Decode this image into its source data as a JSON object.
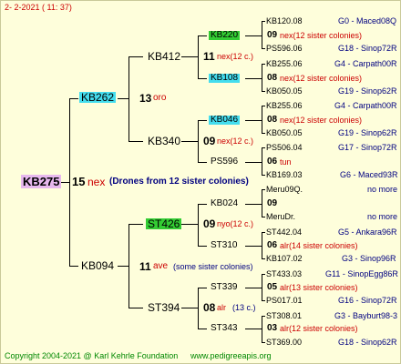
{
  "header": {
    "date": "2-  2-2021  ( 11: 37)"
  },
  "colors": {
    "background": "#fefedb",
    "highlight_blue": "#44ddee",
    "highlight_green": "#33cc33",
    "root_highlight": "#e7b8ee",
    "mating_red": "#cc0000",
    "code_blue": "#000080",
    "footer_green": "#008800"
  },
  "root": {
    "name": "KB275",
    "num": "15",
    "mating": "nex",
    "note": "(Drones from 12 sister colonies)"
  },
  "g1": [
    {
      "name": "KB262",
      "num": "13",
      "mating": "oro"
    },
    {
      "name": "KB094",
      "num": "11",
      "mating": "ave",
      "note": "(some sister colonies)"
    }
  ],
  "g2": [
    {
      "name": "KB412",
      "num": "11",
      "mating": "nex(12 c.)"
    },
    {
      "name": "KB340",
      "num": "09",
      "mating": "nex(12 c.)"
    },
    {
      "name": "ST426",
      "num": "09",
      "mating": "nyo(12 c.)"
    },
    {
      "name": "ST394",
      "num": "08",
      "mating": "alr",
      "note": "(13 c.)"
    }
  ],
  "g3": [
    {
      "name": "KB220",
      "num": "09",
      "mating": "nex(12 sister colonies)"
    },
    {
      "name": "KB108",
      "num": "08",
      "mating": "nex(12 sister colonies)"
    },
    {
      "name": "KB046",
      "num": "08",
      "mating": "nex(12 sister colonies)"
    },
    {
      "name": "PS596",
      "num": "06",
      "mating": "tun"
    },
    {
      "name": "KB024",
      "num": "09",
      "mating": ""
    },
    {
      "name": "ST310",
      "num": "06",
      "mating": "alr(14 sister colonies)"
    },
    {
      "name": "ST339",
      "num": "05",
      "mating": "alr(13 sister colonies)"
    },
    {
      "name": "ST343",
      "num": "03",
      "mating": "alr(12 sister colonies)"
    }
  ],
  "g4": [
    {
      "name": "KB120.08",
      "code": "G0 - Maced08Q"
    },
    {
      "name": "PS596.06",
      "code": "G18 - Sinop72R"
    },
    {
      "name": "KB255.06",
      "code": "G4 - Carpath00R"
    },
    {
      "name": "KB050.05",
      "code": "G19 - Sinop62R"
    },
    {
      "name": "KB255.06",
      "code": "G4 - Carpath00R"
    },
    {
      "name": "KB050.05",
      "code": "G19 - Sinop62R"
    },
    {
      "name": "PS506.04",
      "code": "G17 - Sinop72R"
    },
    {
      "name": "KB169.03",
      "code": "G6 - Maced93R"
    },
    {
      "name": "Meru09Q.",
      "code": "no more"
    },
    {
      "name": "MeruDr.",
      "code": "no more"
    },
    {
      "name": "ST442.04",
      "code": "G5 - Ankara96R"
    },
    {
      "name": "KB107.02",
      "code": "G3 - Sinop96R"
    },
    {
      "name": "ST433.03",
      "code": "G11 - SinopEgg86R"
    },
    {
      "name": "PS017.01",
      "code": "G16 - Sinop72R"
    },
    {
      "name": "ST308.01",
      "code": "G3 - Bayburt98-3"
    },
    {
      "name": "ST369.00",
      "code": "G18 - Sinop62R"
    }
  ],
  "footer": {
    "copyright": "Copyright 2004-2021 @ Karl Kehrle Foundation",
    "url": "www.pedigreeapis.org"
  }
}
